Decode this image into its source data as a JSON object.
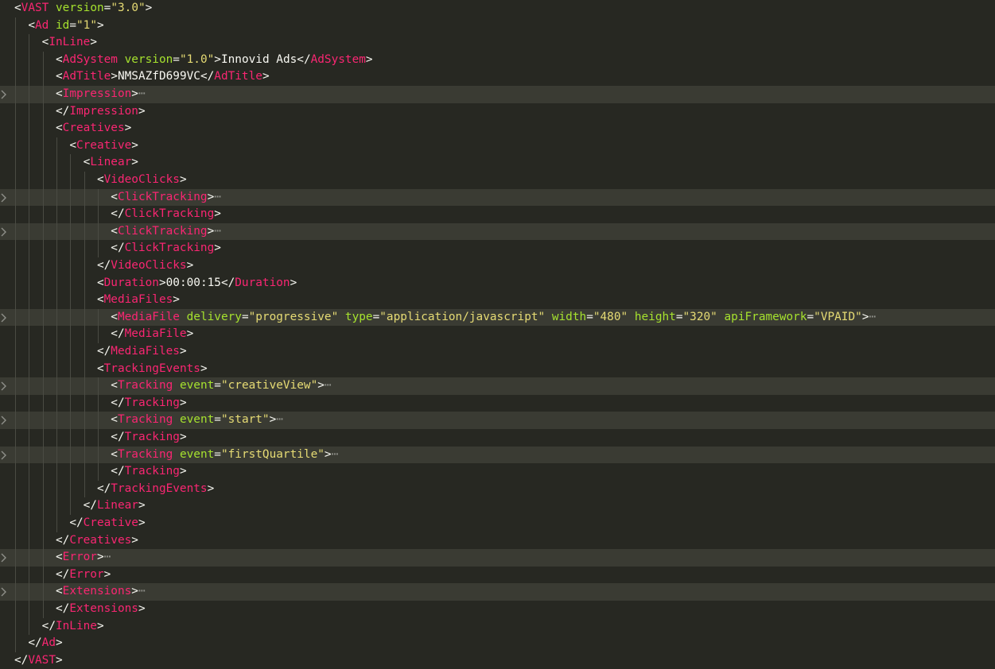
{
  "editor": {
    "lines": [
      {
        "indent": 0,
        "folded": false,
        "tokens": [
          {
            "c": "p",
            "t": "<"
          },
          {
            "c": "t",
            "t": "VAST"
          },
          {
            "c": "x",
            "t": " "
          },
          {
            "c": "a",
            "t": "version"
          },
          {
            "c": "p",
            "t": "="
          },
          {
            "c": "s",
            "t": "\"3.0\""
          },
          {
            "c": "p",
            "t": ">"
          }
        ]
      },
      {
        "indent": 1,
        "folded": false,
        "tokens": [
          {
            "c": "p",
            "t": "<"
          },
          {
            "c": "t",
            "t": "Ad"
          },
          {
            "c": "x",
            "t": " "
          },
          {
            "c": "a",
            "t": "id"
          },
          {
            "c": "p",
            "t": "="
          },
          {
            "c": "s",
            "t": "\"1\""
          },
          {
            "c": "p",
            "t": ">"
          }
        ]
      },
      {
        "indent": 2,
        "folded": false,
        "tokens": [
          {
            "c": "p",
            "t": "<"
          },
          {
            "c": "t",
            "t": "InLine"
          },
          {
            "c": "p",
            "t": ">"
          }
        ]
      },
      {
        "indent": 3,
        "folded": false,
        "tokens": [
          {
            "c": "p",
            "t": "<"
          },
          {
            "c": "t",
            "t": "AdSystem"
          },
          {
            "c": "x",
            "t": " "
          },
          {
            "c": "a",
            "t": "version"
          },
          {
            "c": "p",
            "t": "="
          },
          {
            "c": "s",
            "t": "\"1.0\""
          },
          {
            "c": "p",
            "t": ">"
          },
          {
            "c": "x",
            "t": "Innovid Ads"
          },
          {
            "c": "p",
            "t": "</"
          },
          {
            "c": "t",
            "t": "AdSystem"
          },
          {
            "c": "p",
            "t": ">"
          }
        ]
      },
      {
        "indent": 3,
        "folded": false,
        "tokens": [
          {
            "c": "p",
            "t": "<"
          },
          {
            "c": "t",
            "t": "AdTitle"
          },
          {
            "c": "p",
            "t": ">"
          },
          {
            "c": "x",
            "t": "NMSAZfD699VC"
          },
          {
            "c": "p",
            "t": "</"
          },
          {
            "c": "t",
            "t": "AdTitle"
          },
          {
            "c": "p",
            "t": ">"
          }
        ]
      },
      {
        "indent": 3,
        "folded": true,
        "tokens": [
          {
            "c": "p",
            "t": "<"
          },
          {
            "c": "t",
            "t": "Impression"
          },
          {
            "c": "p",
            "t": ">"
          },
          {
            "c": "ell",
            "t": "⋯"
          }
        ]
      },
      {
        "indent": 3,
        "folded": false,
        "tokens": [
          {
            "c": "p",
            "t": "</"
          },
          {
            "c": "t",
            "t": "Impression"
          },
          {
            "c": "p",
            "t": ">"
          }
        ]
      },
      {
        "indent": 3,
        "folded": false,
        "tokens": [
          {
            "c": "p",
            "t": "<"
          },
          {
            "c": "t",
            "t": "Creatives"
          },
          {
            "c": "p",
            "t": ">"
          }
        ]
      },
      {
        "indent": 4,
        "folded": false,
        "tokens": [
          {
            "c": "p",
            "t": "<"
          },
          {
            "c": "t",
            "t": "Creative"
          },
          {
            "c": "p",
            "t": ">"
          }
        ]
      },
      {
        "indent": 5,
        "folded": false,
        "tokens": [
          {
            "c": "p",
            "t": "<"
          },
          {
            "c": "t",
            "t": "Linear"
          },
          {
            "c": "p",
            "t": ">"
          }
        ]
      },
      {
        "indent": 6,
        "folded": false,
        "tokens": [
          {
            "c": "p",
            "t": "<"
          },
          {
            "c": "t",
            "t": "VideoClicks"
          },
          {
            "c": "p",
            "t": ">"
          }
        ]
      },
      {
        "indent": 7,
        "folded": true,
        "tokens": [
          {
            "c": "p",
            "t": "<"
          },
          {
            "c": "t",
            "t": "ClickTracking"
          },
          {
            "c": "p",
            "t": ">"
          },
          {
            "c": "ell",
            "t": "⋯"
          }
        ]
      },
      {
        "indent": 7,
        "folded": false,
        "tokens": [
          {
            "c": "p",
            "t": "</"
          },
          {
            "c": "t",
            "t": "ClickTracking"
          },
          {
            "c": "p",
            "t": ">"
          }
        ]
      },
      {
        "indent": 7,
        "folded": true,
        "tokens": [
          {
            "c": "p",
            "t": "<"
          },
          {
            "c": "t",
            "t": "ClickTracking"
          },
          {
            "c": "p",
            "t": ">"
          },
          {
            "c": "ell",
            "t": "⋯"
          }
        ]
      },
      {
        "indent": 7,
        "folded": false,
        "tokens": [
          {
            "c": "p",
            "t": "</"
          },
          {
            "c": "t",
            "t": "ClickTracking"
          },
          {
            "c": "p",
            "t": ">"
          }
        ]
      },
      {
        "indent": 6,
        "folded": false,
        "tokens": [
          {
            "c": "p",
            "t": "</"
          },
          {
            "c": "t",
            "t": "VideoClicks"
          },
          {
            "c": "p",
            "t": ">"
          }
        ]
      },
      {
        "indent": 6,
        "folded": false,
        "tokens": [
          {
            "c": "p",
            "t": "<"
          },
          {
            "c": "t",
            "t": "Duration"
          },
          {
            "c": "p",
            "t": ">"
          },
          {
            "c": "x",
            "t": "00:00:15"
          },
          {
            "c": "p",
            "t": "</"
          },
          {
            "c": "t",
            "t": "Duration"
          },
          {
            "c": "p",
            "t": ">"
          }
        ]
      },
      {
        "indent": 6,
        "folded": false,
        "tokens": [
          {
            "c": "p",
            "t": "<"
          },
          {
            "c": "t",
            "t": "MediaFiles"
          },
          {
            "c": "p",
            "t": ">"
          }
        ]
      },
      {
        "indent": 7,
        "folded": true,
        "tokens": [
          {
            "c": "p",
            "t": "<"
          },
          {
            "c": "t",
            "t": "MediaFile"
          },
          {
            "c": "x",
            "t": " "
          },
          {
            "c": "a",
            "t": "delivery"
          },
          {
            "c": "p",
            "t": "="
          },
          {
            "c": "s",
            "t": "\"progressive\""
          },
          {
            "c": "x",
            "t": " "
          },
          {
            "c": "a",
            "t": "type"
          },
          {
            "c": "p",
            "t": "="
          },
          {
            "c": "s",
            "t": "\"application/javascript\""
          },
          {
            "c": "x",
            "t": " "
          },
          {
            "c": "a",
            "t": "width"
          },
          {
            "c": "p",
            "t": "="
          },
          {
            "c": "s",
            "t": "\"480\""
          },
          {
            "c": "x",
            "t": " "
          },
          {
            "c": "a",
            "t": "height"
          },
          {
            "c": "p",
            "t": "="
          },
          {
            "c": "s",
            "t": "\"320\""
          },
          {
            "c": "x",
            "t": " "
          },
          {
            "c": "a",
            "t": "apiFramework"
          },
          {
            "c": "p",
            "t": "="
          },
          {
            "c": "s",
            "t": "\"VPAID\""
          },
          {
            "c": "p",
            "t": ">"
          },
          {
            "c": "ell",
            "t": "⋯"
          }
        ]
      },
      {
        "indent": 7,
        "folded": false,
        "tokens": [
          {
            "c": "p",
            "t": "</"
          },
          {
            "c": "t",
            "t": "MediaFile"
          },
          {
            "c": "p",
            "t": ">"
          }
        ]
      },
      {
        "indent": 6,
        "folded": false,
        "tokens": [
          {
            "c": "p",
            "t": "</"
          },
          {
            "c": "t",
            "t": "MediaFiles"
          },
          {
            "c": "p",
            "t": ">"
          }
        ]
      },
      {
        "indent": 6,
        "folded": false,
        "tokens": [
          {
            "c": "p",
            "t": "<"
          },
          {
            "c": "t",
            "t": "TrackingEvents"
          },
          {
            "c": "p",
            "t": ">"
          }
        ]
      },
      {
        "indent": 7,
        "folded": true,
        "tokens": [
          {
            "c": "p",
            "t": "<"
          },
          {
            "c": "t",
            "t": "Tracking"
          },
          {
            "c": "x",
            "t": " "
          },
          {
            "c": "a",
            "t": "event"
          },
          {
            "c": "p",
            "t": "="
          },
          {
            "c": "s",
            "t": "\"creativeView\""
          },
          {
            "c": "p",
            "t": ">"
          },
          {
            "c": "ell",
            "t": "⋯"
          }
        ]
      },
      {
        "indent": 7,
        "folded": false,
        "tokens": [
          {
            "c": "p",
            "t": "</"
          },
          {
            "c": "t",
            "t": "Tracking"
          },
          {
            "c": "p",
            "t": ">"
          }
        ]
      },
      {
        "indent": 7,
        "folded": true,
        "tokens": [
          {
            "c": "p",
            "t": "<"
          },
          {
            "c": "t",
            "t": "Tracking"
          },
          {
            "c": "x",
            "t": " "
          },
          {
            "c": "a",
            "t": "event"
          },
          {
            "c": "p",
            "t": "="
          },
          {
            "c": "s",
            "t": "\"start\""
          },
          {
            "c": "p",
            "t": ">"
          },
          {
            "c": "ell",
            "t": "⋯"
          }
        ]
      },
      {
        "indent": 7,
        "folded": false,
        "tokens": [
          {
            "c": "p",
            "t": "</"
          },
          {
            "c": "t",
            "t": "Tracking"
          },
          {
            "c": "p",
            "t": ">"
          }
        ]
      },
      {
        "indent": 7,
        "folded": true,
        "tokens": [
          {
            "c": "p",
            "t": "<"
          },
          {
            "c": "t",
            "t": "Tracking"
          },
          {
            "c": "x",
            "t": " "
          },
          {
            "c": "a",
            "t": "event"
          },
          {
            "c": "p",
            "t": "="
          },
          {
            "c": "s",
            "t": "\"firstQuartile\""
          },
          {
            "c": "p",
            "t": ">"
          },
          {
            "c": "ell",
            "t": "⋯"
          }
        ]
      },
      {
        "indent": 7,
        "folded": false,
        "tokens": [
          {
            "c": "p",
            "t": "</"
          },
          {
            "c": "t",
            "t": "Tracking"
          },
          {
            "c": "p",
            "t": ">"
          }
        ]
      },
      {
        "indent": 6,
        "folded": false,
        "tokens": [
          {
            "c": "p",
            "t": "</"
          },
          {
            "c": "t",
            "t": "TrackingEvents"
          },
          {
            "c": "p",
            "t": ">"
          }
        ]
      },
      {
        "indent": 5,
        "folded": false,
        "tokens": [
          {
            "c": "p",
            "t": "</"
          },
          {
            "c": "t",
            "t": "Linear"
          },
          {
            "c": "p",
            "t": ">"
          }
        ]
      },
      {
        "indent": 4,
        "folded": false,
        "tokens": [
          {
            "c": "p",
            "t": "</"
          },
          {
            "c": "t",
            "t": "Creative"
          },
          {
            "c": "p",
            "t": ">"
          }
        ]
      },
      {
        "indent": 3,
        "folded": false,
        "tokens": [
          {
            "c": "p",
            "t": "</"
          },
          {
            "c": "t",
            "t": "Creatives"
          },
          {
            "c": "p",
            "t": ">"
          }
        ]
      },
      {
        "indent": 3,
        "folded": true,
        "tokens": [
          {
            "c": "p",
            "t": "<"
          },
          {
            "c": "t",
            "t": "Error"
          },
          {
            "c": "p",
            "t": ">"
          },
          {
            "c": "ell",
            "t": "⋯"
          }
        ]
      },
      {
        "indent": 3,
        "folded": false,
        "tokens": [
          {
            "c": "p",
            "t": "</"
          },
          {
            "c": "t",
            "t": "Error"
          },
          {
            "c": "p",
            "t": ">"
          }
        ]
      },
      {
        "indent": 3,
        "folded": true,
        "tokens": [
          {
            "c": "p",
            "t": "<"
          },
          {
            "c": "t",
            "t": "Extensions"
          },
          {
            "c": "p",
            "t": ">"
          },
          {
            "c": "ell",
            "t": "⋯"
          }
        ]
      },
      {
        "indent": 3,
        "folded": false,
        "tokens": [
          {
            "c": "p",
            "t": "</"
          },
          {
            "c": "t",
            "t": "Extensions"
          },
          {
            "c": "p",
            "t": ">"
          }
        ]
      },
      {
        "indent": 2,
        "folded": false,
        "tokens": [
          {
            "c": "p",
            "t": "</"
          },
          {
            "c": "t",
            "t": "InLine"
          },
          {
            "c": "p",
            "t": ">"
          }
        ]
      },
      {
        "indent": 1,
        "folded": false,
        "tokens": [
          {
            "c": "p",
            "t": "</"
          },
          {
            "c": "t",
            "t": "Ad"
          },
          {
            "c": "p",
            "t": ">"
          }
        ]
      },
      {
        "indent": 0,
        "folded": false,
        "tokens": [
          {
            "c": "p",
            "t": "</"
          },
          {
            "c": "t",
            "t": "VAST"
          },
          {
            "c": "p",
            "t": ">"
          }
        ]
      }
    ],
    "fold_marker_icon": "chevron-right-icon"
  },
  "colors": {
    "background": "#272822",
    "folded_line_background": "#3a3b33",
    "tag": "#f92672",
    "attribute": "#a6e22e",
    "string": "#e6db74",
    "text": "#f8f8f2",
    "indent_guide": "#4a4b43",
    "fold_marker": "#8f908a"
  }
}
